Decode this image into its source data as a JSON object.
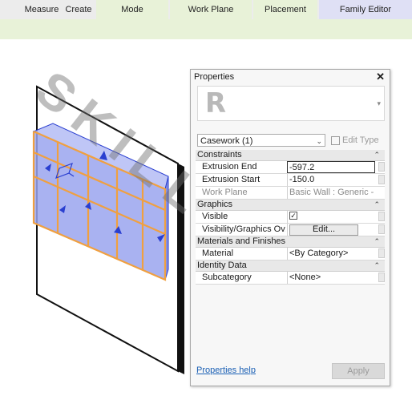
{
  "ribbon": {
    "tabs": [
      "Measure",
      "Create",
      "Mode",
      "Work Plane",
      "Placement",
      "Family Editor"
    ]
  },
  "watermark": "SKILL LYNC",
  "properties": {
    "title": "Properties",
    "close_glyph": "✕",
    "type_selector": "Casework (1)",
    "edit_type_label": "Edit Type",
    "sections": [
      {
        "name": "Constraints",
        "rows": [
          {
            "key": "Extrusion End",
            "value": "-597.2"
          },
          {
            "key": "Extrusion Start",
            "value": "-150.0"
          },
          {
            "key": "Work Plane",
            "value": "Basic Wall : Generic - ..."
          }
        ]
      },
      {
        "name": "Graphics",
        "rows": [
          {
            "key": "Visible",
            "value": "✓"
          },
          {
            "key": "Visibility/Graphics Ov...",
            "value": "Edit..."
          }
        ]
      },
      {
        "name": "Materials and Finishes",
        "rows": [
          {
            "key": "Material",
            "value": "<By Category>"
          }
        ]
      },
      {
        "name": "Identity Data",
        "rows": [
          {
            "key": "Subcategory",
            "value": "<None>"
          }
        ]
      }
    ],
    "help_link": "Properties help",
    "apply_label": "Apply"
  },
  "colors": {
    "ribbon_green": "#e8f2d8",
    "ribbon_purple": "#dfe0f5",
    "glass_fill": "#7f8fe6",
    "frame_orange": "#f0a040"
  },
  "icons": {
    "logo": "revit-r-logo",
    "close": "close-icon",
    "edit_type": "edit-type-icon"
  }
}
